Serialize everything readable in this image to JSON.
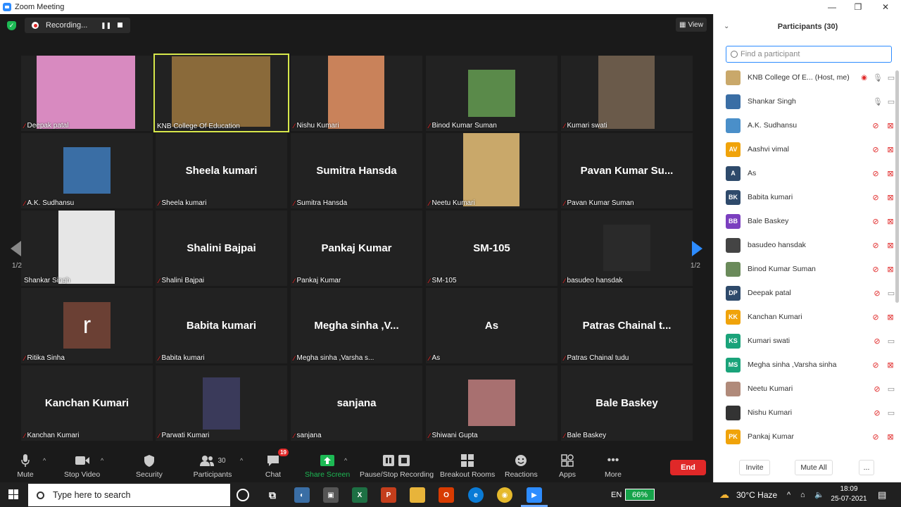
{
  "window": {
    "title": "Zoom Meeting",
    "minimize": "—",
    "maximize": "❐",
    "close": "✕"
  },
  "recording": {
    "text": "Recording...",
    "pause": "❚❚"
  },
  "view_button": {
    "label": "View"
  },
  "pages": {
    "left": "1/2",
    "right": "1/2"
  },
  "tiles": [
    {
      "name": "Deepak patal",
      "big": ""
    },
    {
      "name": "KNB College Of Education",
      "big": ""
    },
    {
      "name": "Nishu Kumari",
      "big": ""
    },
    {
      "name": "Binod Kumar Suman",
      "big": ""
    },
    {
      "name": "Kumari swati",
      "big": ""
    },
    {
      "name": "A.K. Sudhansu",
      "big": ""
    },
    {
      "name": "Sheela kumari",
      "big": "Sheela kumari"
    },
    {
      "name": "Sumitra Hansda",
      "big": "Sumitra Hansda"
    },
    {
      "name": "Neetu Kumari",
      "big": ""
    },
    {
      "name": "Pavan Kumar Suman",
      "big": "Pavan Kumar Su..."
    },
    {
      "name": "Shankar Singh",
      "big": ""
    },
    {
      "name": "Shalini Bajpai",
      "big": "Shalini Bajpai"
    },
    {
      "name": "Pankaj Kumar",
      "big": "Pankaj Kumar"
    },
    {
      "name": "SM-105",
      "big": "SM-105"
    },
    {
      "name": "basudeo hansdak",
      "big": ""
    },
    {
      "name": "Ritika Sinha",
      "big": ""
    },
    {
      "name": "Babita kumari",
      "big": "Babita kumari"
    },
    {
      "name": "Megha sinha ,Varsha s...",
      "big": "Megha sinha ,V..."
    },
    {
      "name": "As",
      "big": "As"
    },
    {
      "name": "Patras Chainal tudu",
      "big": "Patras Chainal t..."
    },
    {
      "name": "Kanchan Kumari",
      "big": "Kanchan Kumari"
    },
    {
      "name": "Parwati Kumari",
      "big": ""
    },
    {
      "name": "sanjana",
      "big": "sanjana"
    },
    {
      "name": "Shiwani Gupta",
      "big": ""
    },
    {
      "name": "Bale Baskey",
      "big": "Bale Baskey"
    }
  ],
  "ritika_initial": "r",
  "toolbar": {
    "mute": "Mute",
    "stop_video": "Stop Video",
    "security": "Security",
    "participants": "Participants",
    "participants_count": "30",
    "chat": "Chat",
    "chat_badge": "19",
    "share_screen": "Share Screen",
    "pause_recording": "Pause/Stop Recording",
    "breakout_rooms": "Breakout Rooms",
    "reactions": "Reactions",
    "apps": "Apps",
    "more": "More",
    "end": "End"
  },
  "panel": {
    "title": "Participants (30)",
    "search_placeholder": "Find a participant",
    "participants": [
      {
        "name": "KNB College Of E...",
        "role": "(Host, me)",
        "avatar": "",
        "color": "#c9a86a",
        "mic": "on",
        "cam": "on",
        "rec": true
      },
      {
        "name": "Shankar Singh",
        "avatar": "",
        "color": "#3a6ea5",
        "mic": "on",
        "cam": "on"
      },
      {
        "name": "A.K. Sudhansu",
        "avatar": "",
        "color": "#4a8fc9",
        "mic": "off",
        "cam": "off"
      },
      {
        "name": "Aashvi vimal",
        "avatar": "AV",
        "color": "#f0a30a",
        "mic": "off",
        "cam": "off"
      },
      {
        "name": "As",
        "avatar": "A",
        "color": "#2e4a6b",
        "mic": "off",
        "cam": "off"
      },
      {
        "name": "Babita kumari",
        "avatar": "BK",
        "color": "#2e4a6b",
        "mic": "off",
        "cam": "off"
      },
      {
        "name": "Bale Baskey",
        "avatar": "BB",
        "color": "#7b3fbf",
        "mic": "off",
        "cam": "off"
      },
      {
        "name": "basudeo hansdak",
        "avatar": "",
        "color": "#444444",
        "mic": "off",
        "cam": "off"
      },
      {
        "name": "Binod Kumar Suman",
        "avatar": "",
        "color": "#6a8a5a",
        "mic": "off",
        "cam": "off"
      },
      {
        "name": "Deepak patal",
        "avatar": "DP",
        "color": "#2e4a6b",
        "mic": "off",
        "cam": "on"
      },
      {
        "name": "Kanchan Kumari",
        "avatar": "KK",
        "color": "#f0a30a",
        "mic": "off",
        "cam": "off"
      },
      {
        "name": "Kumari swati",
        "avatar": "KS",
        "color": "#1aa37a",
        "mic": "off",
        "cam": "on"
      },
      {
        "name": "Megha sinha ,Varsha sinha",
        "avatar": "MS",
        "color": "#1aa37a",
        "mic": "off",
        "cam": "off"
      },
      {
        "name": "Neetu Kumari",
        "avatar": "",
        "color": "#b08a7a",
        "mic": "off",
        "cam": "on"
      },
      {
        "name": "Nishu Kumari",
        "avatar": "",
        "color": "#333333",
        "mic": "off",
        "cam": "on"
      },
      {
        "name": "Pankaj Kumar",
        "avatar": "PK",
        "color": "#f0a30a",
        "mic": "off",
        "cam": "off"
      }
    ],
    "invite": "Invite",
    "mute_all": "Mute All",
    "more": "..."
  },
  "taskbar": {
    "search_placeholder": "Type here to search",
    "lang": "EN",
    "battery": "66%",
    "weather": "30°C  Haze",
    "time": "18:09",
    "date": "25-07-2021"
  }
}
